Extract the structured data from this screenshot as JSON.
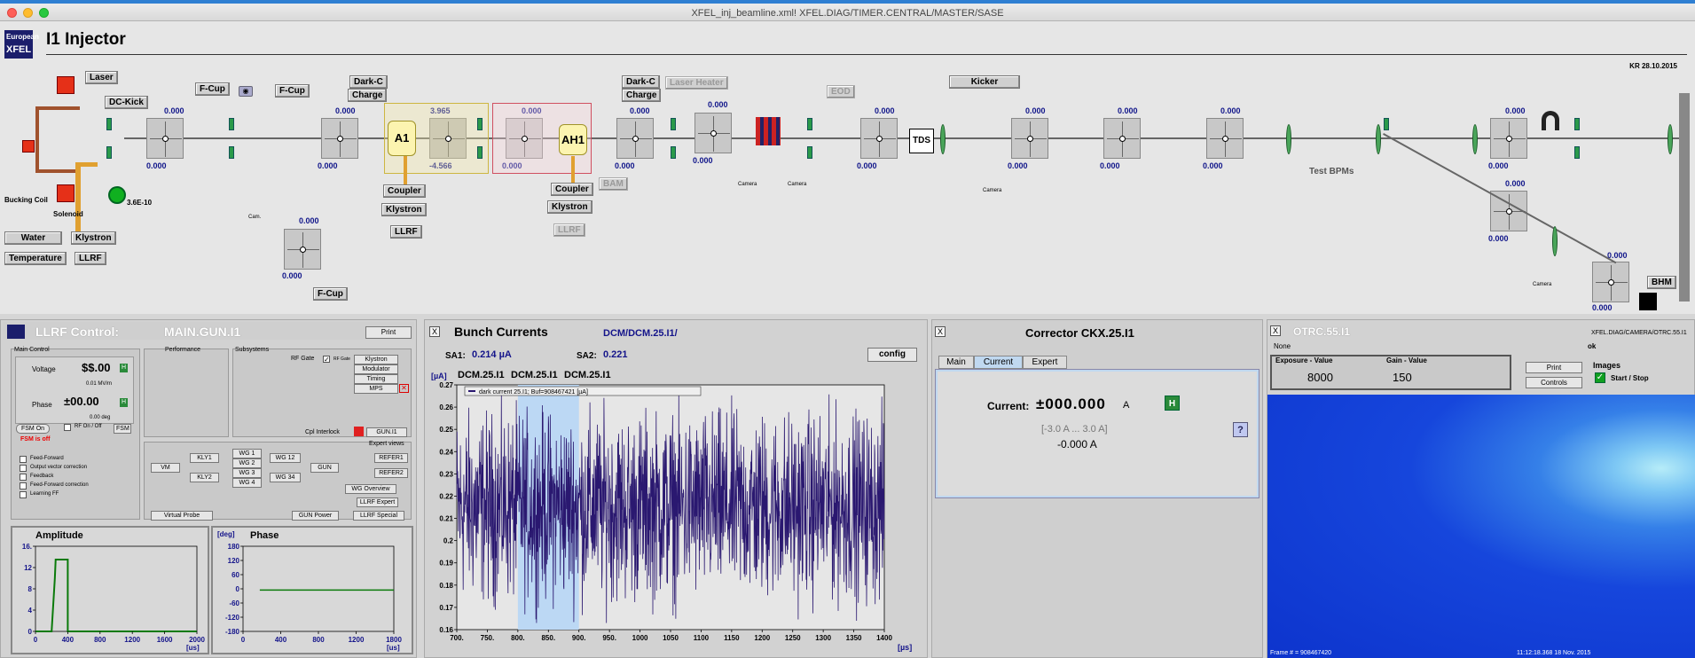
{
  "window": {
    "title": "XFEL_inj_beamline.xml!   XFEL.DIAG/TIMER.CENTRAL/MASTER/SASE"
  },
  "header": {
    "logo_line1": "European",
    "logo_line2": "XFEL",
    "title": "I1 Injector",
    "kr_label": "KR 28.10.2015"
  },
  "synoptic": {
    "buttons": {
      "laser": "Laser",
      "dc_kick": "DC-Kick",
      "fcup1": "F-Cup",
      "fcup2": "F-Cup",
      "fcup3": "F-Cup",
      "darkc1": "Dark-C",
      "charge1": "Charge",
      "darkc2": "Dark-C",
      "charge2": "Charge",
      "laser_heater": "Laser Heater",
      "eod": "EOD",
      "kicker": "Kicker",
      "bam": "BAM",
      "coupler1": "Coupler",
      "klystron1": "Klystron",
      "llrf1": "LLRF",
      "coupler2": "Coupler",
      "klystron2": "Klystron",
      "llrf2": "LLRF",
      "water": "Water",
      "klystron_gun": "Klystron",
      "temperature": "Temperature",
      "llrf_gun": "LLRF",
      "bhm": "BHM"
    },
    "labels": {
      "bucking_coil": "Bucking Coil",
      "solenoid": "Solenoid",
      "vacuum": "3.6E-10",
      "tds": "TDS",
      "a1": "A1",
      "ah1": "AH1",
      "test_bpms": "Test BPMs",
      "cam": "Cam.",
      "camera": "Camera"
    },
    "monitors": [
      {
        "top": "0.000",
        "bottom": "0.000"
      },
      {
        "top": "0.000",
        "bottom": "0.000"
      },
      {
        "top": "3.965",
        "bottom": "-4.566"
      },
      {
        "top": "0.000",
        "bottom": "0.000"
      },
      {
        "top": "0.000",
        "bottom": "0.000"
      },
      {
        "top": "0.000",
        "bottom": "0.000"
      },
      {
        "top": "0.000",
        "bottom": "0.000"
      },
      {
        "top": "0.000",
        "bottom": "0.000"
      },
      {
        "top": "0.000",
        "bottom": "0.000"
      },
      {
        "top": "0.000",
        "bottom": "0.000"
      },
      {
        "top": "0.000",
        "bottom": "0.000"
      },
      {
        "top": "0.000",
        "bottom": "0.000"
      },
      {
        "top": "0.000",
        "bottom": "0.000"
      },
      {
        "top": "0.000",
        "bottom": "0.000"
      }
    ]
  },
  "llrf": {
    "title": "LLRF Control:",
    "device": "MAIN.GUN.I1",
    "print": "Print",
    "main_control": "Main Control",
    "performance": "Performance",
    "subsystems": "Subsystems",
    "voltage_label": "Voltage",
    "voltage_value": "$$.00",
    "voltage_unit": "0.01 MV/m",
    "phase_label": "Phase",
    "phase_value": "±00.00",
    "phase_unit": "0.00 deg",
    "fsm_on": "FSM On",
    "rf_on_off": "RF On / Off",
    "fsm_btn": "FSM",
    "fsm_status": "FSM is off",
    "checks": [
      "Feed-Forward",
      "Output vector correction",
      "Feedback",
      "Feed-Forward correction",
      "Learning FF"
    ],
    "rf_gate": "RF Gate",
    "rf_gate_chk": "RF Gate",
    "sub_buttons": [
      "Klystron",
      "Modulator",
      "Timing",
      "MPS"
    ],
    "cpl_interlock": "Cpl Interlock",
    "gun_i1": "GUN.I1",
    "expert_views": "Expert views",
    "vm": "VM",
    "kly1": "KLY1",
    "kly2": "KLY2",
    "wg1": "WG 1",
    "wg2": "WG 2",
    "wg3": "WG 3",
    "wg4": "WG 4",
    "wg12": "WG 12",
    "wg34": "WG 34",
    "gun": "GUN",
    "refer1": "REFER1",
    "refer2": "REFER2",
    "wg_overview": "WG Overview",
    "llrf_expert": "LLRF Expert",
    "virtual_probe": "Virtual Probe",
    "gun_power": "GUN Power",
    "llrf_special": "LLRF Special",
    "amp_title": "Amplitude",
    "phase_title": "Phase",
    "phase_unit_axis": "[deg]",
    "us": "[us]"
  },
  "bunch": {
    "title": "Bunch Currents",
    "device": "DCM/DCM.25.I1/",
    "sa1_label": "SA1:",
    "sa1_value": "0.214 µA",
    "sa2_label": "SA2:",
    "sa2_value": "0.221",
    "config": "config",
    "unit": "[µA]",
    "xunit": "[µs]",
    "tabs": [
      "DCM.25.I1",
      "DCM.25.I1",
      "DCM.25.I1"
    ],
    "legend": "dark current 25.I1; Buf=908467421 [µA]"
  },
  "corrector": {
    "title": "Corrector CKX.25.I1",
    "tabs": [
      "Main",
      "Current",
      "Expert"
    ],
    "current_label": "Current:",
    "current_value": "±000.000",
    "unit": "A",
    "h_btn": "H",
    "range": "[-3.0 A ... 3.0 A]",
    "readback": "-0.000 A",
    "help": "?"
  },
  "otrc": {
    "title": "OTRC.55.I1",
    "path": "XFEL.DIAG/CAMERA/OTRC.55.I1",
    "none": "None",
    "ok": "ok",
    "exposure_label": "Exposure - Value",
    "exposure_value": "8000",
    "gain_label": "Gain - Value",
    "gain_value": "150",
    "print": "Print",
    "controls": "Controls",
    "images": "Images",
    "start_stop": "Start / Stop",
    "frame": "Frame # = 908467420",
    "timestamp": "11:12:18.368 18 Nov. 2015"
  },
  "chart_data": [
    {
      "type": "line",
      "title": "Amplitude",
      "x": [
        0,
        200,
        240,
        250,
        400,
        400,
        2000
      ],
      "y": [
        0,
        0,
        10,
        13.5,
        13.5,
        0,
        0
      ],
      "xlim": [
        0,
        2000
      ],
      "ylim": [
        0,
        16
      ],
      "xticks": [
        "0",
        "400",
        "800",
        "1200",
        "1600",
        "2000"
      ],
      "yticks": [
        "0",
        "4",
        "8",
        "12",
        "16."
      ],
      "xlabel": "[us]"
    },
    {
      "type": "line",
      "title": "Phase",
      "x": [
        200,
        1800
      ],
      "y": [
        -5,
        -5
      ],
      "xlim": [
        0,
        1800
      ],
      "ylim": [
        -180,
        180
      ],
      "xticks": [
        "0",
        "400",
        "800",
        "1200",
        "1800"
      ],
      "yticks": [
        "-180",
        "-120",
        "-60",
        "0",
        "60",
        "120",
        "180"
      ],
      "xlabel": "[us]",
      "ylabel": "[deg]"
    },
    {
      "type": "line",
      "title": "Bunch Currents",
      "xlim": [
        700,
        1400
      ],
      "ylim": [
        0.16,
        0.27
      ],
      "highlight": [
        800,
        900
      ],
      "mean": 0.215,
      "spread": 0.02,
      "xticks": [
        "700.",
        "750.",
        "800.",
        "850.",
        "900.",
        "950.",
        "1000",
        "1050",
        "1100",
        "1150",
        "1200",
        "1250",
        "1300",
        "1350",
        "1400"
      ],
      "yticks": [
        "0.16",
        "0.17",
        "0.18",
        "0.19",
        "0.2",
        "0.21",
        "0.22",
        "0.23",
        "0.24",
        "0.25",
        "0.26",
        "0.27"
      ],
      "ylabel": "[µA]",
      "xlabel": "[µs]"
    }
  ]
}
